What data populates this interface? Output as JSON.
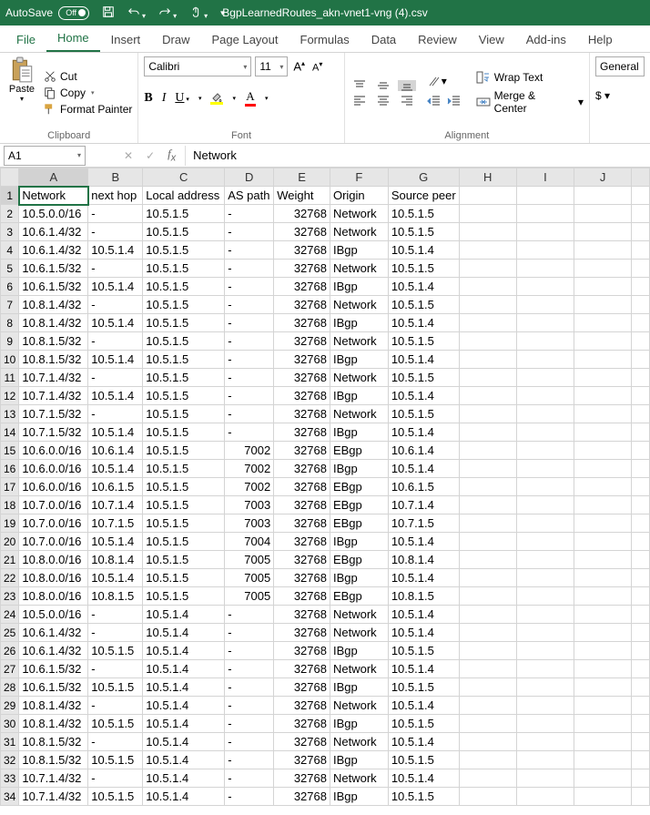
{
  "titlebar": {
    "autosave_label": "AutoSave",
    "autosave_state": "Off",
    "filename": "BgpLearnedRoutes_akn-vnet1-vng (4).csv"
  },
  "tabs": {
    "file": "File",
    "home": "Home",
    "insert": "Insert",
    "draw": "Draw",
    "page_layout": "Page Layout",
    "formulas": "Formulas",
    "data": "Data",
    "review": "Review",
    "view": "View",
    "addins": "Add-ins",
    "help": "Help"
  },
  "ribbon": {
    "paste": "Paste",
    "cut": "Cut",
    "copy": "Copy",
    "format_painter": "Format Painter",
    "clipboard": "Clipboard",
    "font_name": "Calibri",
    "font_size": "11",
    "font_group": "Font",
    "wrap_text": "Wrap Text",
    "merge_center": "Merge & Center",
    "alignment": "Alignment",
    "number_format": "General"
  },
  "namebox": "A1",
  "formula_value": "Network",
  "columns": [
    "A",
    "B",
    "C",
    "D",
    "E",
    "F",
    "G",
    "H",
    "I",
    "J"
  ],
  "headers": [
    "Network",
    "next hop",
    "Local address",
    "AS path",
    "Weight",
    "Origin",
    "Source peer"
  ],
  "rows": [
    [
      "10.5.0.0/16",
      "-",
      "10.5.1.5",
      "-",
      "32768",
      "Network",
      "10.5.1.5"
    ],
    [
      "10.6.1.4/32",
      "-",
      "10.5.1.5",
      "-",
      "32768",
      "Network",
      "10.5.1.5"
    ],
    [
      "10.6.1.4/32",
      "10.5.1.4",
      "10.5.1.5",
      "-",
      "32768",
      "IBgp",
      "10.5.1.4"
    ],
    [
      "10.6.1.5/32",
      "-",
      "10.5.1.5",
      "-",
      "32768",
      "Network",
      "10.5.1.5"
    ],
    [
      "10.6.1.5/32",
      "10.5.1.4",
      "10.5.1.5",
      "-",
      "32768",
      "IBgp",
      "10.5.1.4"
    ],
    [
      "10.8.1.4/32",
      "-",
      "10.5.1.5",
      "-",
      "32768",
      "Network",
      "10.5.1.5"
    ],
    [
      "10.8.1.4/32",
      "10.5.1.4",
      "10.5.1.5",
      "-",
      "32768",
      "IBgp",
      "10.5.1.4"
    ],
    [
      "10.8.1.5/32",
      "-",
      "10.5.1.5",
      "-",
      "32768",
      "Network",
      "10.5.1.5"
    ],
    [
      "10.8.1.5/32",
      "10.5.1.4",
      "10.5.1.5",
      "-",
      "32768",
      "IBgp",
      "10.5.1.4"
    ],
    [
      "10.7.1.4/32",
      "-",
      "10.5.1.5",
      "-",
      "32768",
      "Network",
      "10.5.1.5"
    ],
    [
      "10.7.1.4/32",
      "10.5.1.4",
      "10.5.1.5",
      "-",
      "32768",
      "IBgp",
      "10.5.1.4"
    ],
    [
      "10.7.1.5/32",
      "-",
      "10.5.1.5",
      "-",
      "32768",
      "Network",
      "10.5.1.5"
    ],
    [
      "10.7.1.5/32",
      "10.5.1.4",
      "10.5.1.5",
      "-",
      "32768",
      "IBgp",
      "10.5.1.4"
    ],
    [
      "10.6.0.0/16",
      "10.6.1.4",
      "10.5.1.5",
      "7002",
      "32768",
      "EBgp",
      "10.6.1.4"
    ],
    [
      "10.6.0.0/16",
      "10.5.1.4",
      "10.5.1.5",
      "7002",
      "32768",
      "IBgp",
      "10.5.1.4"
    ],
    [
      "10.6.0.0/16",
      "10.6.1.5",
      "10.5.1.5",
      "7002",
      "32768",
      "EBgp",
      "10.6.1.5"
    ],
    [
      "10.7.0.0/16",
      "10.7.1.4",
      "10.5.1.5",
      "7003",
      "32768",
      "EBgp",
      "10.7.1.4"
    ],
    [
      "10.7.0.0/16",
      "10.7.1.5",
      "10.5.1.5",
      "7003",
      "32768",
      "EBgp",
      "10.7.1.5"
    ],
    [
      "10.7.0.0/16",
      "10.5.1.4",
      "10.5.1.5",
      "7004",
      "32768",
      "IBgp",
      "10.5.1.4"
    ],
    [
      "10.8.0.0/16",
      "10.8.1.4",
      "10.5.1.5",
      "7005",
      "32768",
      "EBgp",
      "10.8.1.4"
    ],
    [
      "10.8.0.0/16",
      "10.5.1.4",
      "10.5.1.5",
      "7005",
      "32768",
      "IBgp",
      "10.5.1.4"
    ],
    [
      "10.8.0.0/16",
      "10.8.1.5",
      "10.5.1.5",
      "7005",
      "32768",
      "EBgp",
      "10.8.1.5"
    ],
    [
      "10.5.0.0/16",
      "-",
      "10.5.1.4",
      "-",
      "32768",
      "Network",
      "10.5.1.4"
    ],
    [
      "10.6.1.4/32",
      "-",
      "10.5.1.4",
      "-",
      "32768",
      "Network",
      "10.5.1.4"
    ],
    [
      "10.6.1.4/32",
      "10.5.1.5",
      "10.5.1.4",
      "-",
      "32768",
      "IBgp",
      "10.5.1.5"
    ],
    [
      "10.6.1.5/32",
      "-",
      "10.5.1.4",
      "-",
      "32768",
      "Network",
      "10.5.1.4"
    ],
    [
      "10.6.1.5/32",
      "10.5.1.5",
      "10.5.1.4",
      "-",
      "32768",
      "IBgp",
      "10.5.1.5"
    ],
    [
      "10.8.1.4/32",
      "-",
      "10.5.1.4",
      "-",
      "32768",
      "Network",
      "10.5.1.4"
    ],
    [
      "10.8.1.4/32",
      "10.5.1.5",
      "10.5.1.4",
      "-",
      "32768",
      "IBgp",
      "10.5.1.5"
    ],
    [
      "10.8.1.5/32",
      "-",
      "10.5.1.4",
      "-",
      "32768",
      "Network",
      "10.5.1.4"
    ],
    [
      "10.8.1.5/32",
      "10.5.1.5",
      "10.5.1.4",
      "-",
      "32768",
      "IBgp",
      "10.5.1.5"
    ],
    [
      "10.7.1.4/32",
      "-",
      "10.5.1.4",
      "-",
      "32768",
      "Network",
      "10.5.1.4"
    ],
    [
      "10.7.1.4/32",
      "10.5.1.5",
      "10.5.1.4",
      "-",
      "32768",
      "IBgp",
      "10.5.1.5"
    ]
  ]
}
